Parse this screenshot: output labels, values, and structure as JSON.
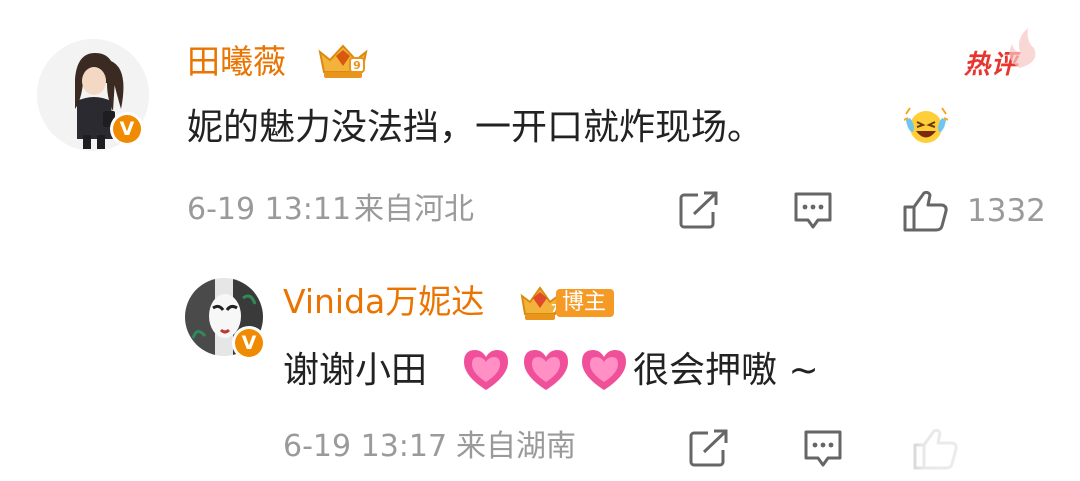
{
  "comment": {
    "username": "田曦薇",
    "verified_mark": "V",
    "hot_label": "热评",
    "text": "妮的魅力没法挡，一开口就炸现场。",
    "emoji": "laughing-crying-emoji",
    "date": "6-19 13:11",
    "location": "来自河北",
    "likes": "1332"
  },
  "reply": {
    "username": "Vinida万妮达",
    "verified_mark": "V",
    "badge_label": "博主",
    "text_before": "谢谢小田",
    "hearts": [
      "💗",
      "💗",
      "💗"
    ],
    "text_after": "很会押嗷 ~",
    "date": "6-19 13:17",
    "location": "来自湖南"
  },
  "colors": {
    "username": "#eb7300",
    "body_text": "#222222",
    "meta_text": "#9a9a9a",
    "hot_label": "#e8352f",
    "badge": "#f49a25",
    "heart": "#f0509a"
  }
}
